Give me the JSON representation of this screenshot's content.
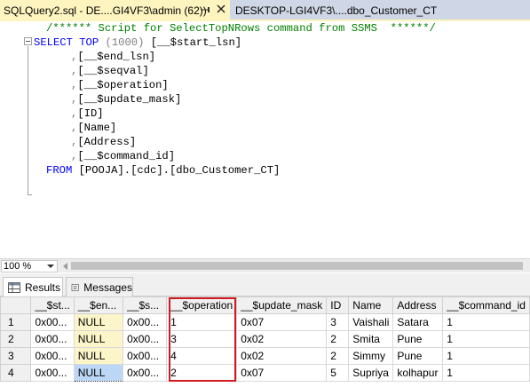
{
  "tabs": [
    {
      "label": "SQLQuery2.sql - DE....GI4VF3\\admin (62))",
      "active": true
    },
    {
      "label": "DESKTOP-LGI4VF3\\....dbo_Customer_CT",
      "active": false
    }
  ],
  "editor": {
    "comment": "/****** Script for SelectTopNRows command from SSMS  ******/",
    "select_keyword": "SELECT",
    "top_keyword": "TOP",
    "top_count": "(1000)",
    "first_column": "[__$start_lsn]",
    "columns": [
      "[__$end_lsn]",
      "[__$seqval]",
      "[__$operation]",
      "[__$update_mask]",
      "[ID]",
      "[Name]",
      "[Address]",
      "[__$command_id]"
    ],
    "from_keyword": "FROM",
    "from_object": "[POOJA].[cdc].[dbo_Customer_CT]"
  },
  "zoom": {
    "value": "100 %"
  },
  "results_tabs": [
    {
      "label": "Results",
      "icon": "results-grid-icon",
      "selected": true
    },
    {
      "label": "Messages",
      "icon": "messages-icon",
      "selected": false
    }
  ],
  "grid": {
    "columns": [
      "",
      "__$st...",
      "__$en...",
      "__$s...",
      "__$operation",
      "__$update_mask",
      "ID",
      "Name",
      "Address",
      "__$command_id"
    ],
    "rows": [
      [
        "1",
        "0x00...",
        "NULL",
        "0x00...",
        "1",
        "0x07",
        "3",
        "Vaishali",
        "Satara",
        "1"
      ],
      [
        "2",
        "0x00...",
        "NULL",
        "0x00...",
        "3",
        "0x02",
        "2",
        "Smita",
        "Pune",
        "1"
      ],
      [
        "3",
        "0x00...",
        "NULL",
        "0x00...",
        "4",
        "0x02",
        "2",
        "Simmy",
        "Pune",
        "1"
      ],
      [
        "4",
        "0x00...",
        "NULL",
        "0x00...",
        "2",
        "0x07",
        "5",
        "Supriya",
        "kolhapur",
        "1"
      ]
    ]
  },
  "colors": {
    "active_tab": "#fdf4bf",
    "keyword": "#0000ff",
    "comment": "#008000",
    "selected_column": "#fbf5c9",
    "highlight_box": "#d11b20"
  }
}
